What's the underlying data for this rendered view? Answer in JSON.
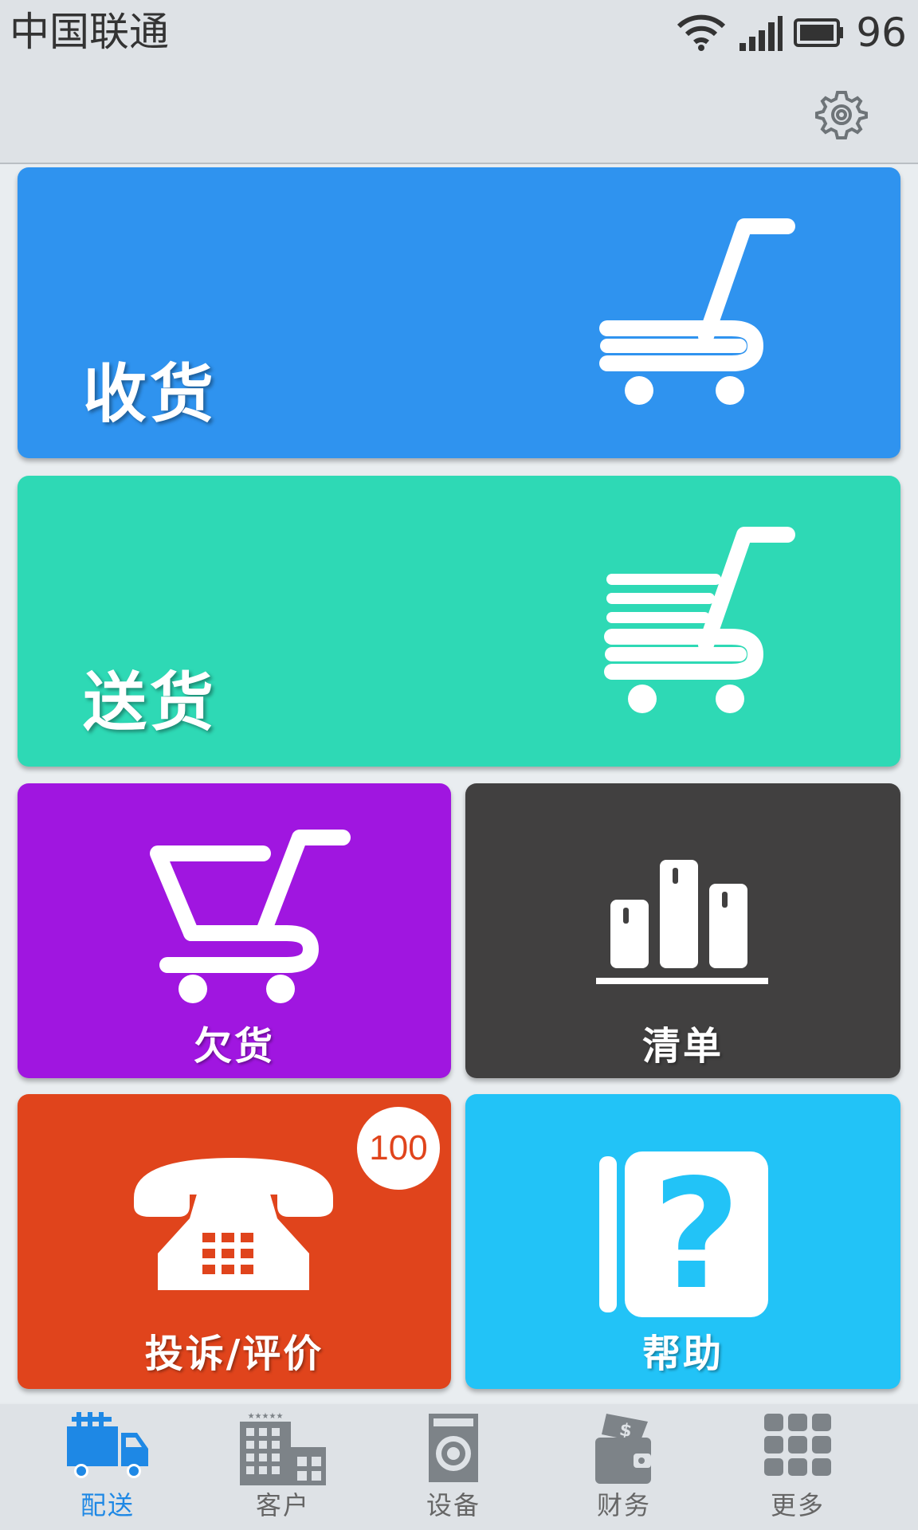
{
  "status_bar": {
    "carrier": "中国联通",
    "battery_percent": "96"
  },
  "tiles": {
    "receive": {
      "label": "收货",
      "color": "#2f93ef",
      "icon": "shopping-cart-icon"
    },
    "deliver": {
      "label": "送货",
      "color": "#2ed9b5",
      "icon": "shopping-cart-with-goods-icon"
    },
    "shortage": {
      "label": "欠货",
      "color": "#a016e0",
      "icon": "empty-cart-icon"
    },
    "list": {
      "label": "清单",
      "color": "#414040",
      "icon": "bar-chart-icon"
    },
    "complaint": {
      "label": "投诉/评价",
      "color": "#e0441c",
      "icon": "telephone-icon",
      "badge": "100"
    },
    "help": {
      "label": "帮助",
      "color": "#22c3f7",
      "icon": "question-book-icon"
    }
  },
  "tabs": [
    {
      "label": "配送",
      "icon": "delivery-truck-icon",
      "active": true
    },
    {
      "label": "客户",
      "icon": "hotel-building-icon",
      "active": false
    },
    {
      "label": "设备",
      "icon": "washing-machine-icon",
      "active": false
    },
    {
      "label": "财务",
      "icon": "wallet-icon",
      "active": false
    },
    {
      "label": "更多",
      "icon": "grid-menu-icon",
      "active": false
    }
  ],
  "colors": {
    "accent": "#1e88e5",
    "inactive_icon": "#7d8388"
  }
}
